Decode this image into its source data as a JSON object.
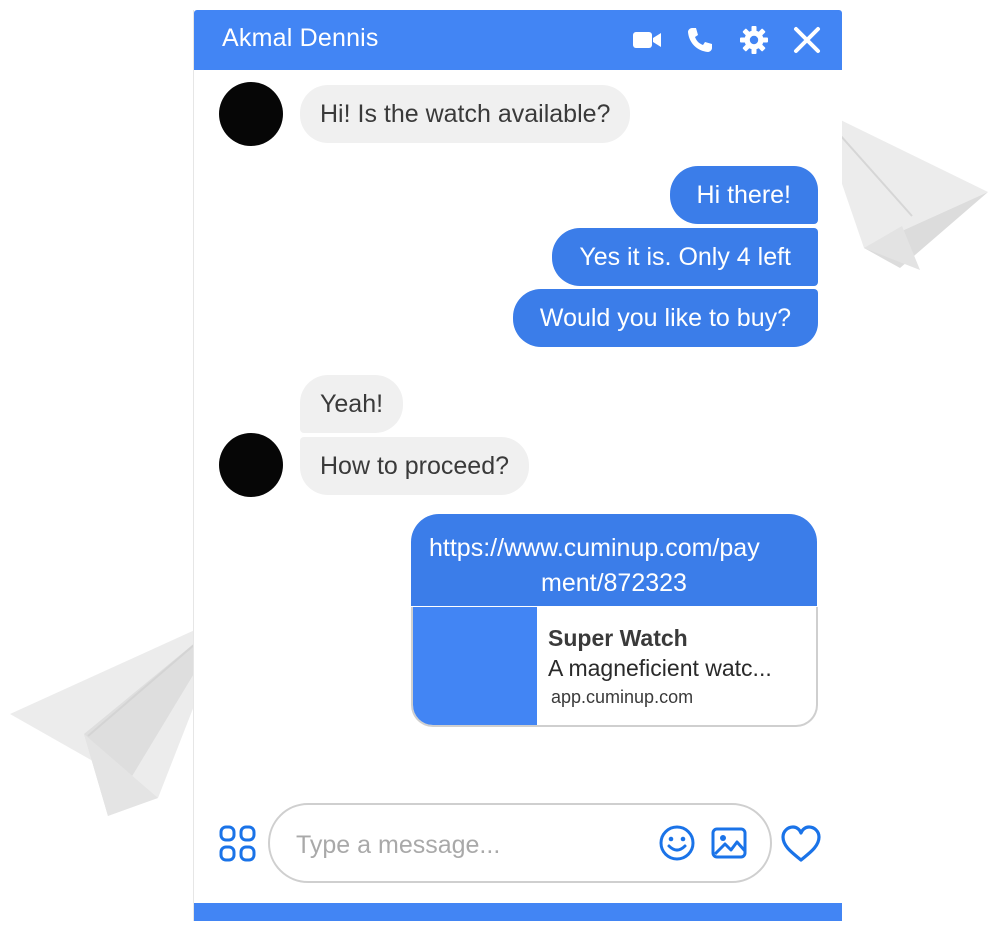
{
  "header": {
    "contact_name": "Akmal Dennis",
    "icons": [
      "video-call-icon",
      "phone-icon",
      "gear-icon",
      "close-icon"
    ]
  },
  "messages": [
    {
      "direction": "incoming",
      "text": "Hi! Is the watch available?"
    },
    {
      "direction": "outgoing",
      "text": "Hi there!"
    },
    {
      "direction": "outgoing",
      "text": "Yes it is. Only 4 left"
    },
    {
      "direction": "outgoing",
      "text": "Would you like to buy?"
    },
    {
      "direction": "incoming",
      "text": "Yeah!"
    },
    {
      "direction": "incoming",
      "text": "How to proceed?"
    }
  ],
  "link_message": {
    "line1": "https://www.cuminup.com/pay",
    "line2": "ment/872323",
    "preview": {
      "title": "Super Watch",
      "description": "A magneficient watc...",
      "domain": "app.cuminup.com"
    }
  },
  "composer": {
    "placeholder": "Type a message...",
    "icons": [
      "apps-icon",
      "emoji-icon",
      "image-icon",
      "heart-icon"
    ]
  },
  "colors": {
    "accent": "#4285f4",
    "outgoing_bubble": "#3b7de9",
    "incoming_bubble": "#f0f0f0",
    "avatar": "#060606",
    "decor_plane": "#e9e9e9"
  }
}
